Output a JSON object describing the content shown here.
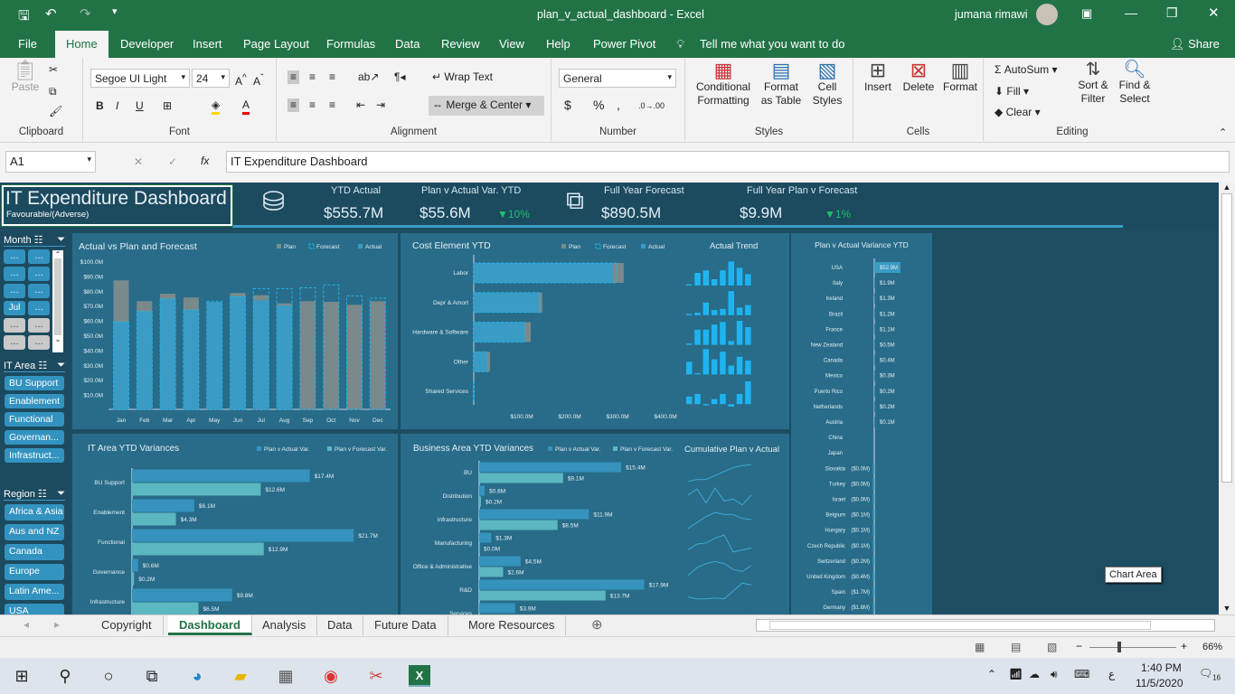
{
  "window": {
    "title": "plan_v_actual_dashboard  -  Excel",
    "user": "jumana rimawi"
  },
  "ribbon_tabs": [
    "File",
    "Home",
    "Developer",
    "Insert",
    "Page Layout",
    "Formulas",
    "Data",
    "Review",
    "View",
    "Help",
    "Power Pivot"
  ],
  "tell_me": "Tell me what you want to do",
  "share": "Share",
  "ribbon": {
    "clipboard": {
      "label": "Clipboard",
      "paste": "Paste"
    },
    "font": {
      "label": "Font",
      "name": "Segoe UI Light",
      "size": "24",
      "bold": "B",
      "italic": "I",
      "underline": "U"
    },
    "alignment": {
      "label": "Alignment",
      "wrap": "Wrap Text",
      "merge": "Merge & Center"
    },
    "number": {
      "label": "Number",
      "format": "General",
      "currency": "$",
      "percent": "%",
      "comma": ","
    },
    "styles": {
      "label": "Styles",
      "cond": "Conditional Formatting",
      "table": "Format as Table",
      "cell": "Cell Styles"
    },
    "cells": {
      "label": "Cells",
      "insert": "Insert",
      "delete": "Delete",
      "format": "Format"
    },
    "editing": {
      "label": "Editing",
      "autosum": "AutoSum",
      "fill": "Fill",
      "clear": "Clear",
      "sort": "Sort & Filter",
      "find": "Find & Select"
    }
  },
  "formula_bar": {
    "name_box": "A1",
    "fx": "fx",
    "formula": "IT Expenditure Dashboard"
  },
  "dashboard": {
    "title": "IT Expenditure Dashboard",
    "subtitle": "Favourable/(Adverse)",
    "kpis": [
      {
        "label": "YTD Actual",
        "value": "$555.7M"
      },
      {
        "label": "Plan v Actual Var. YTD",
        "value": "$55.6M",
        "delta": "▼10%"
      },
      {
        "label": "Full Year Forecast",
        "value": "$890.5M"
      },
      {
        "label": "Full Year Plan v Forecast",
        "value": "$9.9M",
        "delta": "▼1%"
      }
    ],
    "colors": {
      "background": "#1e4d62",
      "panel": "#286c89",
      "plan": "#7a8a8c",
      "actual": "#3a9bc4",
      "forecast": "#1fb4f0",
      "var_actual": "#3593bd",
      "var_forecast": "#5bb7c0",
      "positive": "#19c36a"
    },
    "slicers": {
      "month": {
        "title": "Month",
        "items": [
          "…",
          "…",
          "…",
          "…",
          "…",
          "…",
          "Jul",
          "…",
          "…",
          "…",
          "…",
          "…"
        ],
        "selected": [
          true,
          true,
          true,
          true,
          true,
          true,
          true,
          true,
          false,
          false,
          false,
          false
        ]
      },
      "it_area": {
        "title": "IT Area",
        "items": [
          "BU Support",
          "Enablement",
          "Functional",
          "Governan...",
          "Infrastruct..."
        ]
      },
      "region": {
        "title": "Region",
        "items": [
          "Africa & Asia",
          "Aus and NZ",
          "Canada",
          "Europe",
          "Latin Ame...",
          "USA"
        ]
      }
    },
    "tooltip": "Chart Area"
  },
  "chart_data": [
    {
      "id": "actual_vs_plan",
      "type": "bar",
      "title": "Actual vs Plan and Forecast",
      "legend": [
        "Plan",
        "Forecast",
        "Actual"
      ],
      "legend_position": "top-right",
      "categories": [
        "Jan",
        "Feb",
        "Mar",
        "Apr",
        "May",
        "Jun",
        "Jul",
        "Aug",
        "Sep",
        "Oct",
        "Nov",
        "Dec"
      ],
      "yticks": [
        "$10.0M",
        "$20.0M",
        "$30.0M",
        "$40.0M",
        "$50.0M",
        "$60.0M",
        "$70.0M",
        "$80.0M",
        "$90.0M",
        "$100.0M"
      ],
      "ylim": [
        0,
        100
      ],
      "unit": "$M",
      "series": [
        {
          "name": "Plan",
          "values": [
            87,
            73,
            78,
            75.5,
            72,
            78.5,
            77,
            71.5,
            73,
            72.5,
            70.5,
            73
          ]
        },
        {
          "name": "Actual",
          "values": [
            59,
            66,
            74.5,
            67,
            72.5,
            76,
            73.5,
            70,
            null,
            null,
            null,
            null
          ]
        },
        {
          "name": "Forecast",
          "values": [
            59,
            66,
            74.5,
            67,
            73,
            76,
            81.5,
            81.5,
            82,
            84,
            76.5,
            75
          ]
        }
      ]
    },
    {
      "id": "cost_element",
      "type": "bar",
      "orientation": "horizontal",
      "title": "Cost Element YTD",
      "legend": [
        "Plan",
        "Forecast",
        "Actual"
      ],
      "categories": [
        "Labor",
        "Depr & Amort",
        "Hardware & Software",
        "Other",
        "Shared Services"
      ],
      "xticks": [
        "$100.0M",
        "$200.0M",
        "$300.0M",
        "$400.0M"
      ],
      "xlim": [
        0,
        400
      ],
      "unit": "$M",
      "series": [
        {
          "name": "Plan",
          "values": [
            313,
            143,
            119,
            34,
            1
          ]
        },
        {
          "name": "Actual",
          "values": [
            290,
            136,
            106,
            28,
            1
          ]
        },
        {
          "name": "Forecast",
          "values": [
            297,
            138,
            106,
            28,
            1
          ]
        }
      ]
    },
    {
      "id": "actual_trend",
      "type": "bar",
      "title": "Actual Trend",
      "rows": [
        [
          0.5,
          5,
          6,
          2.5,
          6,
          9.5,
          7,
          4.5
        ],
        [
          0.5,
          1,
          5,
          2,
          2.5,
          9.5,
          3,
          4
        ],
        [
          0.5,
          6,
          6,
          8,
          9,
          1.5,
          9.5,
          7
        ],
        [
          5,
          0.5,
          10,
          6,
          9,
          3.5,
          7,
          5.5
        ],
        [
          3,
          4,
          -0.5,
          2,
          4,
          -1,
          4,
          9
        ]
      ]
    },
    {
      "id": "country_variance",
      "type": "bar",
      "orientation": "horizontal",
      "title": "Plan v Actual Variance YTD",
      "categories": [
        "USA",
        "Italy",
        "Ireland",
        "Brazil",
        "France",
        "New Zealand",
        "Canada",
        "Mexico",
        "Puerto Rico",
        "Netherlands",
        "Austria",
        "China",
        "Japan",
        "Slovakia",
        "Turkey",
        "Israel",
        "Belgium",
        "Hungary",
        "Czech Republic",
        "Switzerland",
        "United Kingdom",
        "Spain",
        "Germany"
      ],
      "values": [
        52.9,
        1.9,
        1.3,
        1.2,
        1.1,
        0.5,
        0.4,
        0.3,
        0.2,
        0.2,
        0.1,
        null,
        null,
        -0.0,
        -0.0,
        -0.0,
        -0.1,
        -0.1,
        -0.1,
        -0.2,
        -0.4,
        -1.7,
        -1.8
      ],
      "labels": [
        "$52.9M",
        "$1.9M",
        "$1.3M",
        "$1.2M",
        "$1.1M",
        "$0.5M",
        "$0.4M",
        "$0.3M",
        "$0.2M",
        "$0.2M",
        "$0.1M",
        "",
        "",
        "($0.0M)",
        "($0.0M)",
        "($0.0M)",
        "($0.1M)",
        "($0.1M)",
        "($0.1M)",
        "($0.2M)",
        "($0.4M)",
        "($1.7M)",
        "($1.8M)"
      ]
    },
    {
      "id": "it_area_var",
      "type": "bar",
      "orientation": "horizontal",
      "title": "IT Area YTD Variances",
      "legend": [
        "Plan v Actual Var.",
        "Plan v Forecast Var."
      ],
      "categories": [
        "BU Support",
        "Enablement",
        "Functional",
        "Governance",
        "Infrastructure"
      ],
      "series": [
        {
          "name": "Plan v Actual Var.",
          "values": [
            17.4,
            6.1,
            21.7,
            0.6,
            9.8
          ],
          "labels": [
            "$17.4M",
            "$6.1M",
            "$21.7M",
            "$0.6M",
            "$9.8M"
          ]
        },
        {
          "name": "Plan v Forecast Var.",
          "values": [
            12.6,
            4.3,
            12.9,
            0.2,
            6.5
          ],
          "labels": [
            "$12.6M",
            "$4.3M",
            "$12.9M",
            "$0.2M",
            "$6.5M"
          ]
        }
      ]
    },
    {
      "id": "business_area_var",
      "type": "bar",
      "orientation": "horizontal",
      "title": "Business Area YTD Variances",
      "legend": [
        "Plan v Actual Var.",
        "Plan v Forecast Var."
      ],
      "categories": [
        "BU",
        "Distribution",
        "Infrastructure",
        "Manufacturing",
        "Office & Administrative",
        "R&D",
        "Services"
      ],
      "series": [
        {
          "name": "Plan v Actual Var.",
          "values": [
            15.4,
            0.6,
            11.9,
            1.3,
            4.5,
            17.9,
            3.9
          ],
          "labels": [
            "$15.4M",
            "$0.6M",
            "$11.9M",
            "$1.3M",
            "$4.5M",
            "$17.9M",
            "$3.9M"
          ]
        },
        {
          "name": "Plan v Forecast Var.",
          "values": [
            9.1,
            0.2,
            8.5,
            0.0,
            2.6,
            13.7,
            null
          ],
          "labels": [
            "$9.1M",
            "$0.2M",
            "$8.5M",
            "$0.0M",
            "$2.6M",
            "$13.7M",
            ""
          ]
        }
      ]
    },
    {
      "id": "cumulative",
      "type": "line",
      "title": "Cumulative Plan v Actual",
      "rows": [
        [
          1,
          2,
          2,
          4,
          6,
          8,
          9,
          9.5
        ],
        [
          6,
          9,
          2,
          9.5,
          3,
          4,
          1,
          6
        ],
        [
          1,
          4,
          7,
          9,
          8,
          8,
          6,
          5.5
        ],
        [
          2,
          5,
          5.5,
          8,
          9.5,
          1,
          2,
          3
        ],
        [
          1,
          5,
          7,
          8,
          7,
          4,
          3,
          6
        ],
        [
          2,
          1,
          1,
          1.5,
          1,
          5,
          9,
          8
        ],
        [
          1,
          1,
          1,
          1,
          1,
          3,
          4,
          5
        ]
      ]
    }
  ],
  "sheet_tabs": [
    "Copyright",
    "Dashboard",
    "Analysis",
    "Data",
    "Future Data",
    "More Resources"
  ],
  "active_sheet": "Dashboard",
  "status": {
    "zoom": "66%"
  },
  "taskbar": {
    "time": "1:40 PM",
    "date": "11/5/2020",
    "lang": "ع",
    "notifications": "16"
  }
}
